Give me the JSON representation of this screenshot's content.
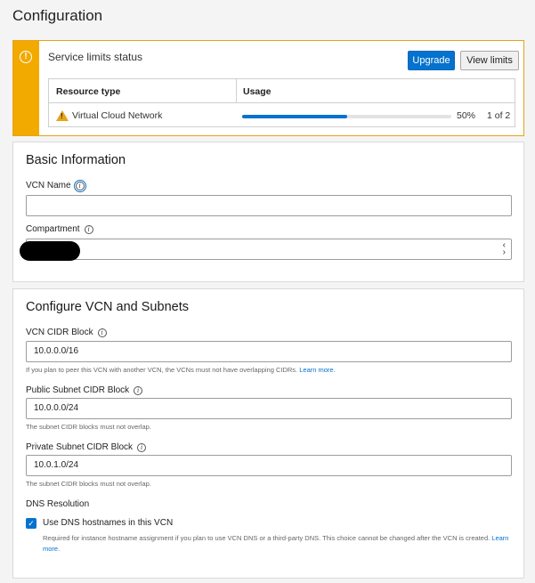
{
  "page": {
    "title": "Configuration"
  },
  "limits": {
    "title": "Service limits status",
    "upgrade_label": "Upgrade",
    "view_limits_label": "View limits",
    "table": {
      "headers": [
        "Resource type",
        "Usage"
      ],
      "rows": [
        {
          "resource": "Virtual Cloud Network",
          "usage_fraction": 0.5,
          "percent": "50%",
          "count": "1 of 2"
        }
      ]
    }
  },
  "basic": {
    "title": "Basic Information",
    "vcn_name_label": "VCN Name",
    "vcn_name_value": "",
    "compartment_label": "Compartment",
    "compartment_value": ""
  },
  "subnets": {
    "title": "Configure VCN and Subnets",
    "vcn_cidr_label": "VCN CIDR Block",
    "vcn_cidr_value": "10.0.0.0/16",
    "vcn_cidr_help": "If you plan to peer this VCN with another VCN, the VCNs must not have overlapping CIDRs.",
    "learn_more": "Learn more.",
    "public_label": "Public Subnet CIDR Block",
    "public_value": "10.0.0.0/24",
    "public_help": "The subnet CIDR blocks must not overlap.",
    "private_label": "Private Subnet CIDR Block",
    "private_value": "10.0.1.0/24",
    "private_help": "The subnet CIDR blocks must not overlap.",
    "dns_heading": "DNS Resolution",
    "dns_checkbox_label": "Use DNS hostnames in this VCN",
    "dns_checked": true,
    "dns_help": "Required for instance hostname assignment if you plan to use VCN DNS or a third-party DNS. This choice cannot be changed after the VCN is created.",
    "dns_learn_more_1": "Learn",
    "dns_learn_more_2": "more."
  },
  "colors": {
    "accent": "#0572ce",
    "warning": "#f2a900"
  },
  "icons": {
    "warning": "alert-circle-icon",
    "info": "info-icon",
    "triangle": "warning-triangle-icon",
    "chevron": "up-down-chevron-icon",
    "check": "check-icon"
  }
}
